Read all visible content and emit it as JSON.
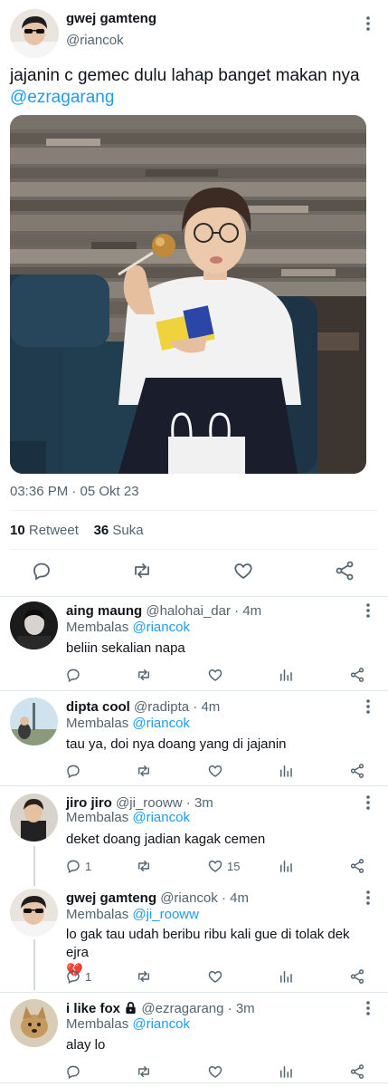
{
  "main_tweet": {
    "name": "gwej gamteng",
    "handle": "@riancok",
    "text": "jajanin c gemec dulu lahap banget makan nya",
    "mention": "@ezragarang",
    "time": "03:36 PM · 05 Okt 23",
    "retweet_count": "10",
    "retweet_label": "Retweet",
    "like_count": "36",
    "like_label": "Suka"
  },
  "replies": [
    {
      "name": "aing maung",
      "handle": "@halohai_dar",
      "age": "4m",
      "replying_label": "Membalas",
      "replying_to": "@riancok",
      "text": "beliin sekalian napa",
      "reply_count": "",
      "like_count": ""
    },
    {
      "name": "dipta cool",
      "handle": "@radipta",
      "age": "4m",
      "replying_label": "Membalas",
      "replying_to": "@riancok",
      "text": "tau ya, doi nya doang yang di jajanin",
      "reply_count": "",
      "like_count": ""
    },
    {
      "name": "jiro jiro",
      "handle": "@ji_rooww",
      "age": "3m",
      "replying_label": "Membalas",
      "replying_to": "@riancok",
      "text": "deket doang jadian kagak cemen",
      "reply_count": "1",
      "like_count": "15"
    },
    {
      "name": "gwej gamteng",
      "handle": "@riancok",
      "age": "4m",
      "replying_label": "Membalas",
      "replying_to": "@ji_rooww",
      "text": "lo gak tau udah beribu ribu kali gue di tolak dek ejra",
      "emoji": "💔",
      "reply_count": "1",
      "like_count": ""
    },
    {
      "name": "i like fox",
      "handle": "@ezragarang",
      "age": "3m",
      "replying_label": "Membalas",
      "replying_to": "@riancok",
      "text": "alay lo",
      "reply_count": "",
      "like_count": ""
    }
  ],
  "colors": {
    "accent": "#1d9bf0",
    "secondary_text": "#536471",
    "divider": "#eff3f4"
  },
  "icons": [
    "more-vertical-icon",
    "reply-icon",
    "retweet-icon",
    "like-icon",
    "views-icon",
    "share-icon",
    "lock-icon",
    "broken-heart-emoji"
  ]
}
